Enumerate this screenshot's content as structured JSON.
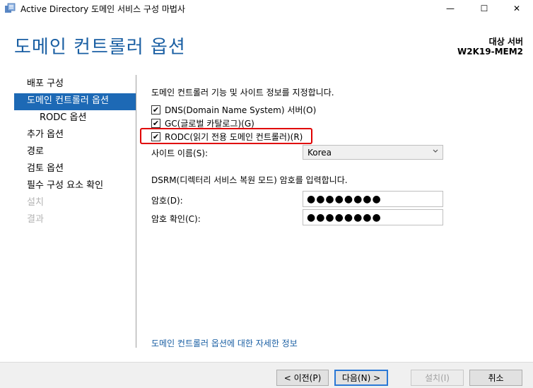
{
  "window": {
    "title": "Active Directory 도메인 서비스 구성 마법사",
    "minimize_glyph": "—",
    "maximize_glyph": "☐",
    "close_glyph": "✕"
  },
  "header": {
    "title": "도메인 컨트롤러 옵션",
    "target_label": "대상 서버",
    "target_server": "W2K19-MEM2"
  },
  "nav": {
    "items": [
      {
        "label": "배포 구성",
        "state": "normal"
      },
      {
        "label": "도메인 컨트롤러 옵션",
        "state": "active"
      },
      {
        "label": "RODC 옵션",
        "state": "sub"
      },
      {
        "label": "추가 옵션",
        "state": "normal"
      },
      {
        "label": "경로",
        "state": "normal"
      },
      {
        "label": "검토 옵션",
        "state": "normal"
      },
      {
        "label": "필수 구성 요소 확인",
        "state": "normal"
      },
      {
        "label": "설치",
        "state": "disabled"
      },
      {
        "label": "결과",
        "state": "disabled"
      }
    ]
  },
  "main": {
    "description": "도메인 컨트롤러 기능 및 사이트 정보를 지정합니다.",
    "checkboxes": {
      "dns": {
        "label": "DNS(Domain Name System) 서버(O)",
        "checked": true
      },
      "gc": {
        "label": "GC(글로벌 카탈로그)(G)",
        "checked": true
      },
      "rodc": {
        "label": "RODC(읽기 전용 도메인 컨트롤러)(R)",
        "checked": true
      }
    },
    "check_glyph": "✔",
    "site_label": "사이트 이름(S):",
    "site_value": "Korea",
    "dsrm_description": "DSRM(디렉터리 서비스 복원 모드) 암호를 입력합니다.",
    "password_label": "암호(D):",
    "password_value": "●●●●●●●●",
    "confirm_label": "암호 확인(C):",
    "confirm_value": "●●●●●●●●",
    "more_info_link": "도메인 컨트롤러 옵션에 대한 자세한 정보"
  },
  "footer": {
    "prev_label": "< 이전(P)",
    "next_label": "다음(N) >",
    "install_label": "설치(I)",
    "cancel_label": "취소"
  },
  "colors": {
    "accent": "#1d69b5",
    "title": "#1a5fa3",
    "highlight": "#e00000"
  }
}
